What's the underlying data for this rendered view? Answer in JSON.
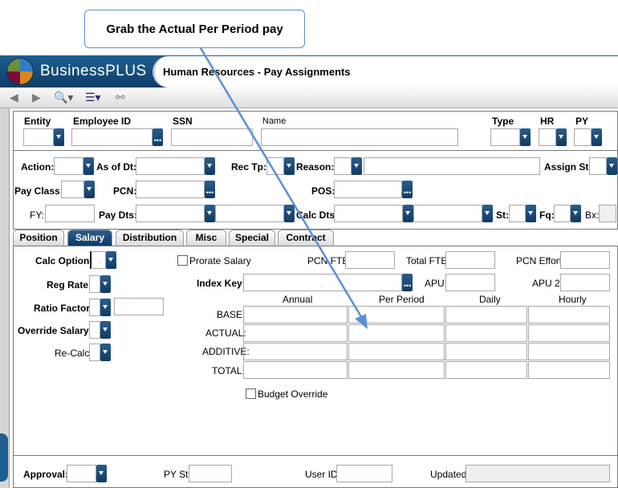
{
  "callout": {
    "text": "Grab the Actual Per Period pay"
  },
  "header": {
    "brand": "BusinessPLUS",
    "title": "Human Resources - Pay Assignments"
  },
  "toolbar": {
    "icons": [
      "back-arrow-icon",
      "forward-arrow-icon",
      "search-icon",
      "menu-icon",
      "link-icon"
    ]
  },
  "top_fields": {
    "entity": "Entity",
    "employee_id": "Employee ID",
    "ssn": "SSN",
    "name": "Name",
    "type": "Type",
    "hr": "HR",
    "py": "PY"
  },
  "mid_fields": {
    "action": "Action:",
    "as_of_dt": "As of Dt:",
    "rec_tp": "Rec Tp:",
    "reason": "Reason:",
    "assign_st": "Assign St:",
    "pay_class": "Pay Class:",
    "pcn": "PCN:",
    "pos": "POS:",
    "fy": "FY:",
    "pay_dts": "Pay Dts:",
    "calc_dts": "Calc Dts:",
    "st": "St:",
    "fq": "Fq:",
    "bx": "Bx:"
  },
  "tabs": [
    {
      "label": "Position",
      "active": false
    },
    {
      "label": "Salary",
      "active": true
    },
    {
      "label": "Distribution",
      "active": false
    },
    {
      "label": "Misc",
      "active": false
    },
    {
      "label": "Special",
      "active": false
    },
    {
      "label": "Contract",
      "active": false
    }
  ],
  "salary": {
    "calc_option": "Calc Option:",
    "reg_rate": "Reg Rate:",
    "ratio_factor": "Ratio Factor:",
    "override_salary": "Override Salary:",
    "re_calc": "Re-Calc:",
    "prorate_salary": "Prorate Salary",
    "pcn_fte": "PCN FTE:",
    "total_fte": "Total FTE:",
    "pcn_effort": "PCN Effort:",
    "index_key": "Index Key:",
    "apu": "APU:",
    "apu2": "APU 2:",
    "columns": [
      "Annual",
      "Per Period",
      "Daily",
      "Hourly"
    ],
    "rows": [
      "BASE:",
      "ACTUAL:",
      "ADDITIVE:",
      "TOTAL:"
    ],
    "budget_override": "Budget Override"
  },
  "footer": {
    "approval": "Approval:",
    "py_st": "PY St:",
    "user_id": "User ID:",
    "updated": "Updated:"
  },
  "colors": {
    "accent": "#0f3a64",
    "arrow": "#5b8fd6"
  }
}
